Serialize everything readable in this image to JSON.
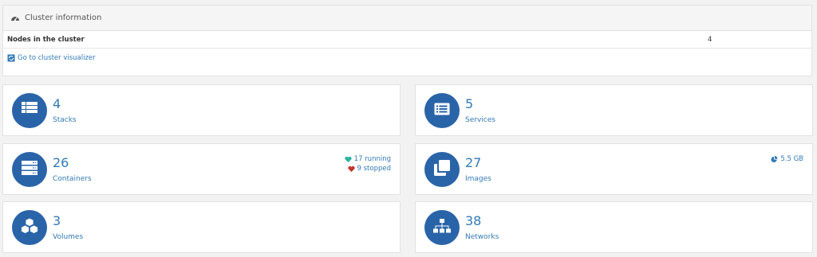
{
  "cluster": {
    "title": "Cluster information",
    "nodes_label": "Nodes in the cluster",
    "nodes_value": "4",
    "visualizer_link": "Go to cluster visualizer"
  },
  "cards": {
    "stacks": {
      "count": "4",
      "label": "Stacks",
      "icon": "list-icon"
    },
    "services": {
      "count": "5",
      "label": "Services",
      "icon": "list-alt-icon"
    },
    "containers": {
      "count": "26",
      "label": "Containers",
      "icon": "server-icon",
      "running": "17 running",
      "stopped": "9 stopped"
    },
    "images": {
      "count": "27",
      "label": "Images",
      "icon": "clone-icon",
      "size": "5.5 GB"
    },
    "volumes": {
      "count": "3",
      "label": "Volumes",
      "icon": "cubes-icon"
    },
    "networks": {
      "count": "38",
      "label": "Networks",
      "icon": "sitemap-icon"
    }
  },
  "colors": {
    "accent": "#337ab7",
    "circle": "#2a64a8",
    "running": "#2bb5a0",
    "stopped": "#c0392b"
  }
}
